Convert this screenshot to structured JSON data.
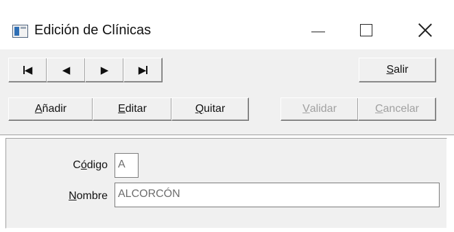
{
  "window": {
    "title": "Edición de Clínicas"
  },
  "toolbar": {
    "nav": [
      {
        "name": "first",
        "icon": "first-record-icon"
      },
      {
        "name": "prev",
        "icon": "previous-record-icon"
      },
      {
        "name": "next",
        "icon": "next-record-icon"
      },
      {
        "name": "last",
        "icon": "last-record-icon"
      }
    ],
    "salir": {
      "pre": "",
      "ul": "S",
      "post": "alir"
    },
    "anadir": {
      "pre": "",
      "ul": "A",
      "post": "ñadir"
    },
    "editar": {
      "pre": "",
      "ul": "E",
      "post": "ditar"
    },
    "quitar": {
      "pre": "",
      "ul": "Q",
      "post": "uitar"
    },
    "validar": {
      "pre": "",
      "ul": "V",
      "post": "alidar"
    },
    "cancelar": {
      "pre": "",
      "ul": "C",
      "post": "ancelar"
    }
  },
  "form": {
    "codigo": {
      "label_pre": "C",
      "label_ul": "ó",
      "label_post": "digo",
      "value": "A"
    },
    "nombre": {
      "label_pre": "",
      "label_ul": "N",
      "label_post": "ombre",
      "value": "ALCORCÓN"
    }
  },
  "colors": {
    "face": "#f0f0f0",
    "disabled_text": "#a0a0a0",
    "field_text": "#6d6d6d"
  }
}
